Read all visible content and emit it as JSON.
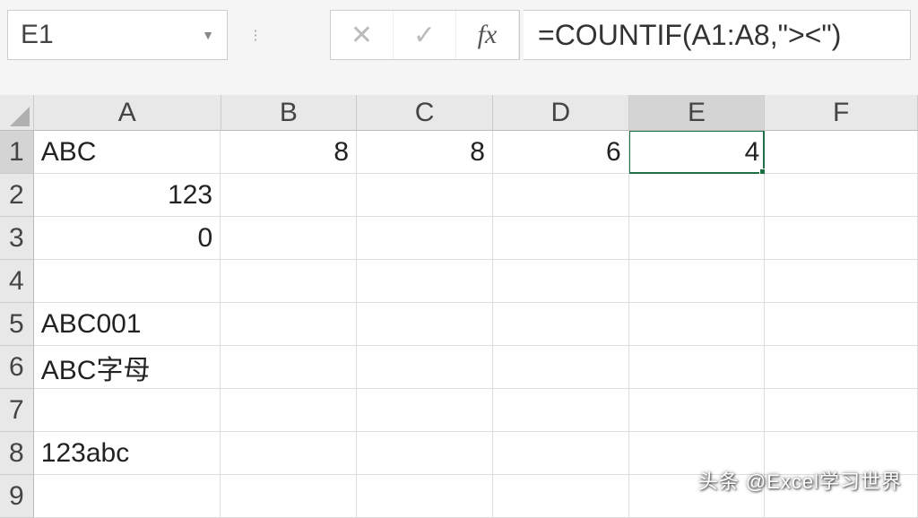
{
  "namebox": {
    "cell_ref": "E1"
  },
  "formula_bar": {
    "content": "=COUNTIF(A1:A8,\"><\")"
  },
  "columns": [
    "A",
    "B",
    "C",
    "D",
    "E",
    "F"
  ],
  "rows": [
    "1",
    "2",
    "3",
    "4",
    "5",
    "6",
    "7",
    "8",
    "9"
  ],
  "cells": {
    "A1": {
      "v": "ABC",
      "align": "left"
    },
    "B1": {
      "v": "8",
      "align": "right"
    },
    "C1": {
      "v": "8",
      "align": "right"
    },
    "D1": {
      "v": "6",
      "align": "right"
    },
    "E1": {
      "v": "4",
      "align": "right"
    },
    "A2": {
      "v": "123",
      "align": "right"
    },
    "A3": {
      "v": "0",
      "align": "right"
    },
    "A5": {
      "v": "ABC001",
      "align": "left"
    },
    "A6": {
      "v": "ABC字母",
      "align": "left"
    },
    "A8": {
      "v": "123abc",
      "align": "left"
    }
  },
  "selected_cell": "E1",
  "icons": {
    "cancel": "✕",
    "confirm": "✓",
    "fx": "fx",
    "dropdown": "▼"
  },
  "watermark": "头条 @Excel学习世界"
}
